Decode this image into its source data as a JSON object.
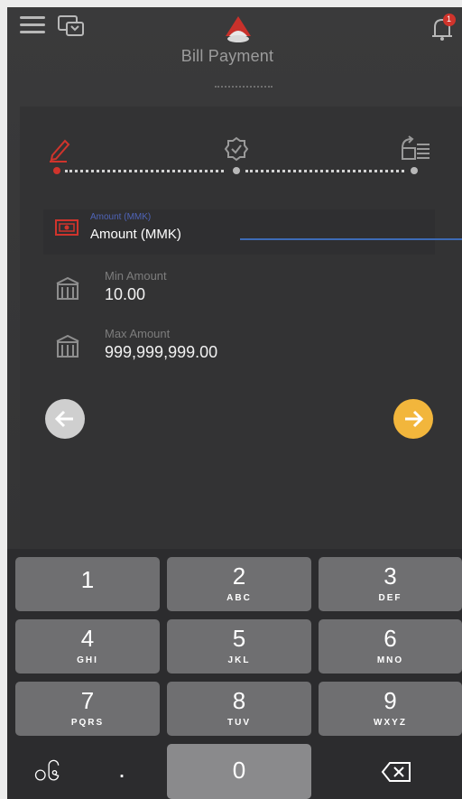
{
  "header": {
    "title": "Bill Payment",
    "menu_icon": "hamburger-menu-icon",
    "swap_icon": "currency-exchange-icon",
    "logo_icon": "bank-logo-icon",
    "notification_icon": "bell-icon",
    "notification_badge": "1"
  },
  "stepper": {
    "steps": [
      {
        "icon": "edit-pencil-icon",
        "state": "active"
      },
      {
        "icon": "verified-badge-icon",
        "state": "pending"
      },
      {
        "icon": "receipt-list-icon",
        "state": "pending"
      }
    ]
  },
  "amount_field": {
    "floating_label": "Amount (MMK)",
    "value": "Amount (MMK)",
    "icon": "cash-icon"
  },
  "limits": {
    "min_label": "Min Amount",
    "min_value": "10.00",
    "max_label": "Max Amount",
    "max_value": "999,999,999.00",
    "icon": "bank-building-icon"
  },
  "navigation": {
    "back_icon": "arrow-left-icon",
    "next_icon": "arrow-right-icon"
  },
  "keypad": {
    "keys": [
      {
        "digit": "1",
        "letters": ""
      },
      {
        "digit": "2",
        "letters": "ABC"
      },
      {
        "digit": "3",
        "letters": "DEF"
      },
      {
        "digit": "4",
        "letters": "GHI"
      },
      {
        "digit": "5",
        "letters": "JKL"
      },
      {
        "digit": "6",
        "letters": "MNO"
      },
      {
        "digit": "7",
        "letters": "PQRS"
      },
      {
        "digit": "8",
        "letters": "TUV"
      },
      {
        "digit": "9",
        "letters": "WXYZ"
      }
    ],
    "zero": "0",
    "symbol_key": "၀၆",
    "decimal_key": ".",
    "backspace_icon": "backspace-icon"
  },
  "colors": {
    "accent_red": "#d0342c",
    "accent_yellow": "#f2b63c",
    "field_underline": "#3d6bb6"
  }
}
